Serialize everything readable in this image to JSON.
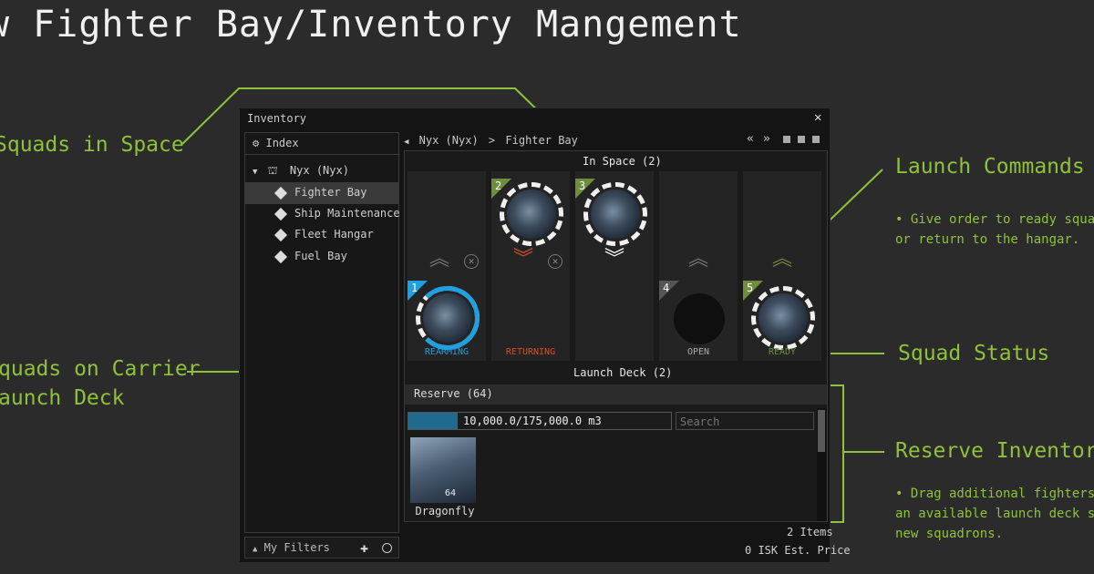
{
  "page": {
    "title": "w Fighter Bay/Inventory Mangement"
  },
  "annotations": {
    "squads_in_space": "Squads in Space",
    "launch_commands": "Launch Commands",
    "launch_commands_desc_1": "• Give order to ready squad",
    "launch_commands_desc_2": "or return to the hangar.",
    "squads_on_carrier_1": "quads on Carrier",
    "squads_on_carrier_2": "aunch Deck",
    "squad_status": "Squad Status",
    "reserve_inventory": "Reserve Inventory",
    "reserve_desc_1": "• Drag additional fighters fr",
    "reserve_desc_2": "an available launch deck slo",
    "reserve_desc_3": "new squadrons."
  },
  "colors": {
    "accent_green": "#8fc23b",
    "rearming_blue": "#1fa0e0",
    "returning_red": "#d2502a",
    "ready_green": "#6d8e3a",
    "capacity_fill": "#1f6a8e"
  },
  "window": {
    "title": "Inventory",
    "close_icon": "close-icon",
    "sidebar": {
      "index_label": "Index",
      "ship_label": "Nyx (Nyx)",
      "items": [
        {
          "label": "Fighter Bay",
          "selected": true
        },
        {
          "label": "Ship Maintenance",
          "selected": false
        },
        {
          "label": "Fleet Hangar",
          "selected": false
        },
        {
          "label": "Fuel Bay",
          "selected": false
        }
      ],
      "filters_label": "My Filters"
    },
    "breadcrumb": {
      "ship": "Nyx (Nyx)",
      "separator": ">",
      "location": "Fighter Bay"
    },
    "in_space_label": "In Space (2)",
    "launch_deck_label": "Launch Deck (2)",
    "slots": [
      {
        "number": "1",
        "status": "REARMING",
        "status_color": "#1fa0e0",
        "fighter": true,
        "in_space": false,
        "progress": 0.75
      },
      {
        "number": "2",
        "status": "RETURNING",
        "status_color": "#d2502a",
        "fighter": true,
        "in_space": true
      },
      {
        "number": "3",
        "status": "",
        "status_color": "#ffffff",
        "fighter": true,
        "in_space": true
      },
      {
        "number": "4",
        "status": "OPEN",
        "status_color": "#aaaaaa",
        "fighter": false,
        "in_space": false
      },
      {
        "number": "5",
        "status": "READY",
        "status_color": "#6d8e3a",
        "fighter": true,
        "in_space": false
      }
    ],
    "reserve": {
      "header": "Reserve (64)",
      "capacity_text": "10,000.0/175,000.0 m3",
      "capacity_fraction": 0.0571,
      "search_placeholder": "Search",
      "item": {
        "name": "Dragonfly",
        "quantity": "64"
      }
    },
    "footer": {
      "items_count": "2 Items",
      "est_price": "0 ISK Est. Price"
    }
  }
}
